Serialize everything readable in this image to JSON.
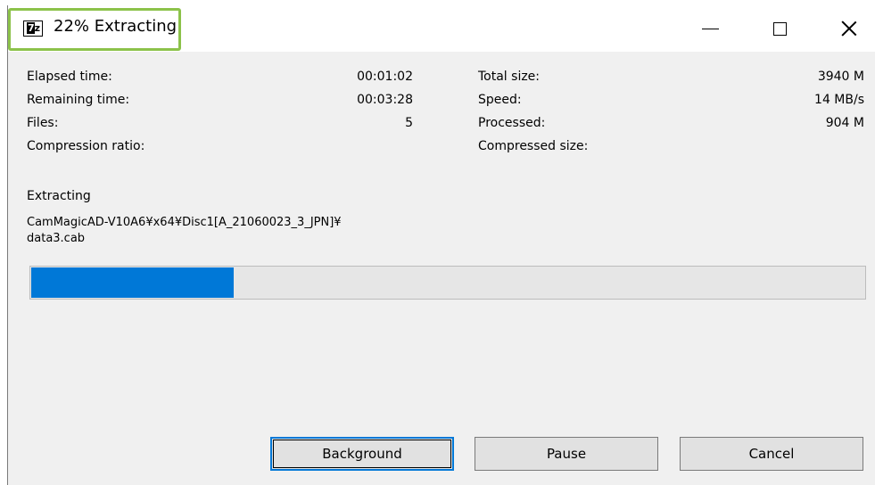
{
  "window": {
    "title": "22% Extracting",
    "icon": "7z-app-icon",
    "controls": [
      "minimize-icon",
      "maximize-icon",
      "close-icon"
    ]
  },
  "stats": {
    "elapsed_label": "Elapsed time:",
    "elapsed_value": "00:01:02",
    "remaining_label": "Remaining time:",
    "remaining_value": "00:03:28",
    "files_label": "Files:",
    "files_value": "5",
    "ratio_label": "Compression ratio:",
    "total_label": "Total size:",
    "total_value": "3940 M",
    "speed_label": "Speed:",
    "speed_value": "14 MB/s",
    "processed_label": "Processed:",
    "processed_value": "904 M",
    "compressed_label": "Compressed size:"
  },
  "operation": {
    "label": "Extracting",
    "path_line1": "CamMagicAD-V10A6¥x64¥Disc1[A_21060023_3_JPN]¥",
    "path_line2": "data3.cab"
  },
  "progress": {
    "fraction": 0.243,
    "color": "#0078d7"
  },
  "buttons": {
    "background": "Background",
    "pause": "Pause",
    "cancel": "Cancel"
  }
}
